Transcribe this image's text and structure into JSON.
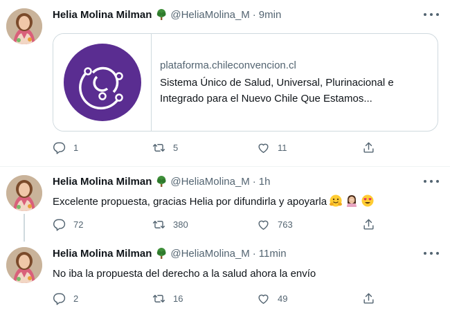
{
  "tweets": [
    {
      "name": "Helia Molina Milman",
      "handle": "@HeliaMolina_M",
      "separator": "·",
      "time": "9min",
      "card": {
        "domain": "plataforma.chileconvencion.cl",
        "description": "Sistema Único de Salud, Universal, Plurinacional e Integrado para el Nuevo Chile Que Estamos..."
      },
      "replies": "1",
      "retweets": "5",
      "likes": "11"
    },
    {
      "name": "Helia Molina Milman",
      "handle": "@HeliaMolina_M",
      "separator": "·",
      "time": "1h",
      "text": "Excelente propuesta, gracias Helia por difundirla y apoyarla",
      "replies": "72",
      "retweets": "380",
      "likes": "763"
    },
    {
      "name": "Helia Molina Milman",
      "handle": "@HeliaMolina_M",
      "separator": "·",
      "time": "11min",
      "text": "No iba la propuesta del derecho a la salud ahora la envío",
      "replies": "2",
      "retweets": "16",
      "likes": "49"
    }
  ],
  "colors": {
    "text": "#0f1419",
    "secondary": "#536471",
    "border": "#cfd9de",
    "card_logo": "#5a2d91"
  },
  "icons": [
    "tree-emoji-icon",
    "more-icon",
    "reply-icon",
    "retweet-icon",
    "like-icon",
    "share-icon",
    "hugging-face-emoji-icon",
    "woman-facepalming-emoji-icon",
    "heart-eyes-emoji-icon"
  ]
}
